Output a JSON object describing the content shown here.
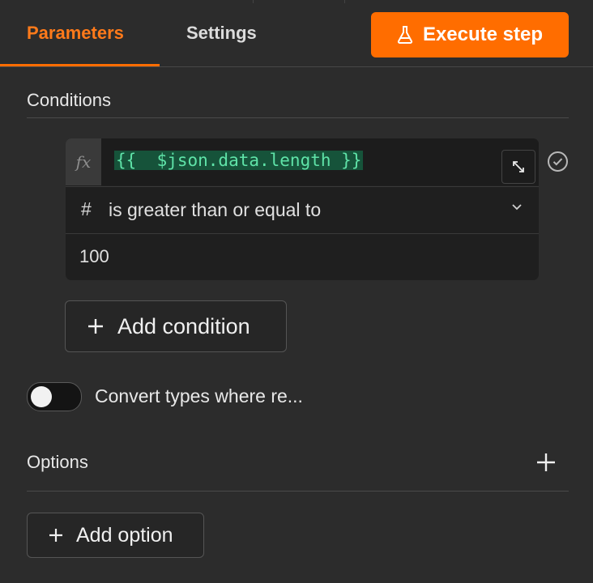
{
  "tabs": [
    {
      "label": "Parameters",
      "active": true
    },
    {
      "label": "Settings",
      "active": false
    }
  ],
  "execute_button": {
    "label": "Execute step",
    "icon": "flask-icon",
    "color": "#ff6d00"
  },
  "conditions": {
    "heading": "Conditions",
    "items": [
      {
        "fx_label": "fx",
        "expression": "{{  $json.data.length }}",
        "operator_type_icon": "#",
        "operator": "is greater than or equal to",
        "value": "100"
      }
    ],
    "add_button": {
      "label": "Add condition",
      "icon": "plus-icon"
    }
  },
  "convert_types": {
    "label": "Convert types where re...",
    "enabled": false
  },
  "options": {
    "heading": "Options",
    "add_button": {
      "label": "Add option",
      "icon": "plus-icon"
    }
  },
  "colors": {
    "accent": "#ff6d00",
    "expression_text": "#5fe3a8",
    "expression_bg": "#16533a",
    "background": "#2c2c2c"
  }
}
